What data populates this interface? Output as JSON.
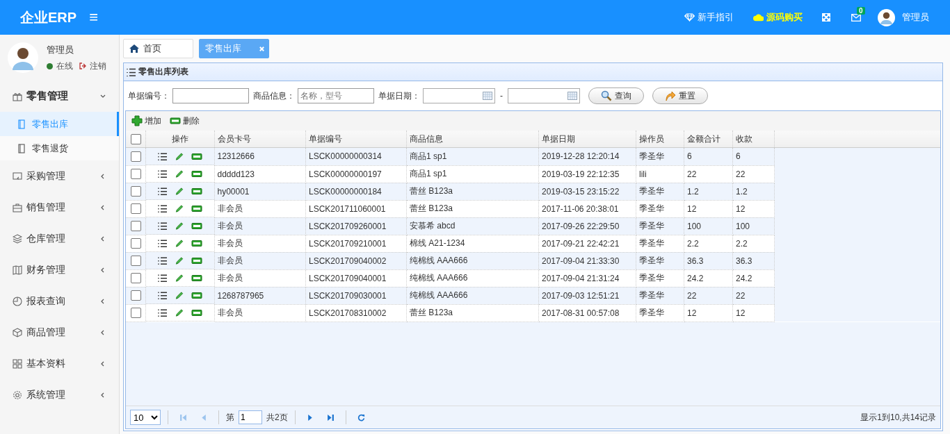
{
  "header": {
    "logo": "企业ERP",
    "menu_icon": "≡",
    "links": [
      {
        "kind": "guide",
        "label": "新手指引"
      },
      {
        "kind": "buy",
        "label": "源码购买"
      }
    ],
    "mail_badge": "0",
    "user": "管理员"
  },
  "user_panel": {
    "name": "管理员",
    "status": "在线",
    "logout": "注销"
  },
  "sidebar": {
    "items": [
      {
        "label": "零售管理",
        "expanded": true,
        "children": [
          {
            "label": "零售出库",
            "selected": true
          },
          {
            "label": "零售退货",
            "selected": false
          }
        ]
      },
      {
        "label": "采购管理",
        "expanded": false
      },
      {
        "label": "销售管理",
        "expanded": false
      },
      {
        "label": "仓库管理",
        "expanded": false
      },
      {
        "label": "财务管理",
        "expanded": false
      },
      {
        "label": "报表查询",
        "expanded": false
      },
      {
        "label": "商品管理",
        "expanded": false
      },
      {
        "label": "基本资料",
        "expanded": false
      },
      {
        "label": "系统管理",
        "expanded": false
      }
    ]
  },
  "tabs": [
    {
      "label": "首页",
      "kind": "home",
      "selected": false
    },
    {
      "label": "零售出库",
      "kind": "closable",
      "selected": true
    }
  ],
  "panel": {
    "title": "零售出库列表",
    "search": {
      "fields": [
        {
          "label": "单据编号：",
          "kind": "text"
        },
        {
          "label": "商品信息：",
          "kind": "text",
          "placeholder": "名称，型号"
        },
        {
          "label": "单据日期：",
          "kind": "daterange",
          "separator": "-"
        }
      ],
      "buttons": [
        {
          "kind": "search",
          "label": "查询"
        },
        {
          "kind": "reset",
          "label": "重置"
        }
      ]
    },
    "toolbar": [
      {
        "kind": "add",
        "label": "增加"
      },
      {
        "kind": "delete",
        "label": "删除"
      }
    ],
    "table": {
      "select_all_checked": false,
      "action_column": "操作",
      "columns": [
        "会员卡号",
        "单据编号",
        "商品信息",
        "单据日期",
        "操作员",
        "金额合计",
        "收款"
      ],
      "rows": [
        {
          "checked": false,
          "cells": [
            "12312666",
            "LSCK00000000314",
            "商品1 sp1",
            "2019-12-28 12:20:14",
            "季圣华",
            "6",
            "6"
          ]
        },
        {
          "checked": false,
          "cells": [
            "ddddd123",
            "LSCK00000000197",
            "商品1 sp1",
            "2019-03-19 22:12:35",
            "lili",
            "22",
            "22"
          ]
        },
        {
          "checked": false,
          "cells": [
            "hy00001",
            "LSCK00000000184",
            "蕾丝 B123a",
            "2019-03-15 23:15:22",
            "季圣华",
            "1.2",
            "1.2"
          ]
        },
        {
          "checked": false,
          "cells": [
            "非会员",
            "LSCK201711060001",
            "蕾丝 B123a",
            "2017-11-06 20:38:01",
            "季圣华",
            "12",
            "12"
          ]
        },
        {
          "checked": false,
          "cells": [
            "非会员",
            "LSCK201709260001",
            "安慕希 abcd",
            "2017-09-26 22:29:50",
            "季圣华",
            "100",
            "100"
          ]
        },
        {
          "checked": false,
          "cells": [
            "非会员",
            "LSCK201709210001",
            "棉线 A21-1234",
            "2017-09-21 22:42:21",
            "季圣华",
            "2.2",
            "2.2"
          ]
        },
        {
          "checked": false,
          "cells": [
            "非会员",
            "LSCK201709040002",
            "纯棉线 AAA666",
            "2017-09-04 21:33:30",
            "季圣华",
            "36.3",
            "36.3"
          ]
        },
        {
          "checked": false,
          "cells": [
            "非会员",
            "LSCK201709040001",
            "纯棉线 AAA666",
            "2017-09-04 21:31:24",
            "季圣华",
            "24.2",
            "24.2"
          ]
        },
        {
          "checked": false,
          "cells": [
            "1268787965",
            "LSCK201709030001",
            "纯棉线 AAA666",
            "2017-09-03 12:51:21",
            "季圣华",
            "22",
            "22"
          ]
        },
        {
          "checked": false,
          "cells": [
            "非会员",
            "LSCK201708310002",
            "蕾丝 B123a",
            "2017-08-31 00:57:08",
            "季圣华",
            "12",
            "12"
          ]
        }
      ]
    },
    "pager": {
      "page_size": "10",
      "page_label": "第",
      "page": "1",
      "total_pages": "共2页",
      "summary": "显示1到10,共14记录"
    }
  }
}
